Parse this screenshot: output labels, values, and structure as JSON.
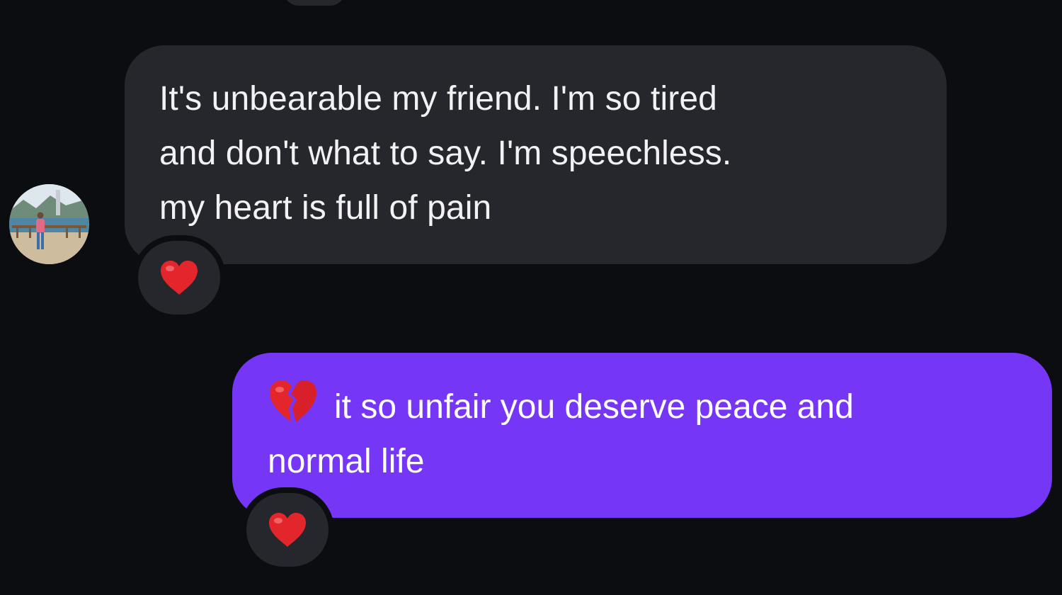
{
  "conversation": {
    "incoming": {
      "lines": [
        "It's unbearable my friend. I'm so tired",
        "and don't what to say. I'm speechless.",
        "my heart is full of pain"
      ],
      "reaction": "red-heart"
    },
    "outgoing": {
      "lead_emoji": "broken-heart",
      "lines": [
        "it so unfair you deserve peace and",
        "normal life"
      ],
      "reaction": "red-heart"
    }
  },
  "colors": {
    "background": "#0c0d11",
    "incoming_bubble": "#25272c",
    "outgoing_bubble": "#7537f5",
    "heart": "#e3262c"
  },
  "icons": {
    "avatar": "contact-avatar-photo",
    "reaction": "red-heart-icon",
    "inline_emoji": "broken-heart-icon"
  }
}
